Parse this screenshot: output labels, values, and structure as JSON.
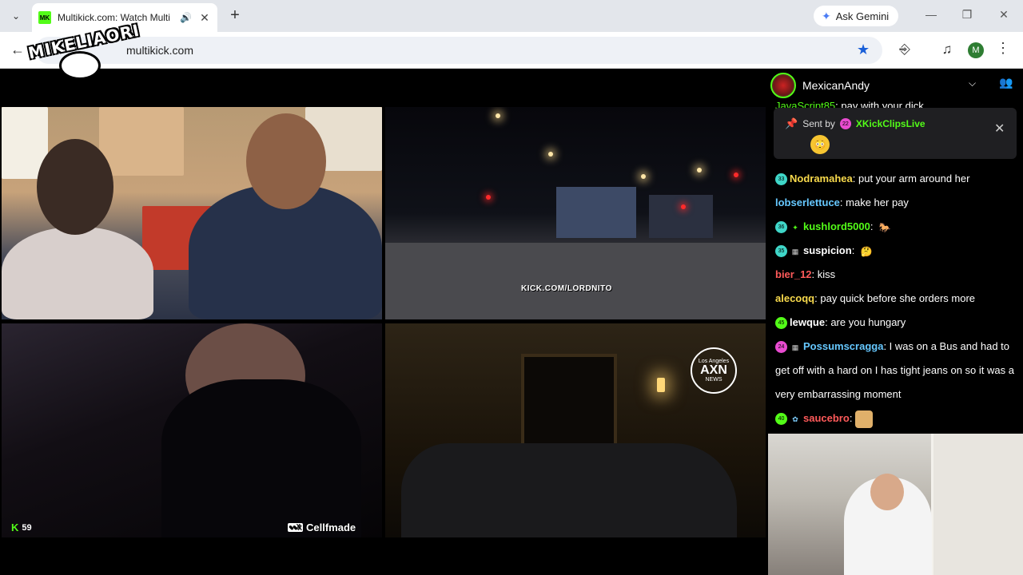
{
  "browser": {
    "tab_title": "Multikick.com: Watch Multi",
    "favicon_text": "MK",
    "new_tab": "+",
    "ask_gemini": "Ask Gemini",
    "url": "multikick.com",
    "profile_initial": "M"
  },
  "watermark": {
    "text": "MIKELIAORI"
  },
  "streams": {
    "tile2_overlay": "KICK.COM/LORDNITO",
    "tile4_logo_top": "Los Angeles",
    "tile4_logo_main": "AXN",
    "tile4_logo_bottom": "NEWS",
    "viewer_count": "59",
    "handle_tag": "Cellfmade"
  },
  "chat": {
    "channel": "MexicanAndy",
    "cut_message": {
      "user": "JavaScript85",
      "text": "pay with your dick"
    },
    "pinned": {
      "sent_by": "Sent by",
      "badge": "22",
      "user": "XKickClipsLive"
    },
    "messages": [
      {
        "badge": "33",
        "user": "Nodramahea",
        "text": "put your arm around her"
      },
      {
        "badge": "",
        "user": "lobserlettuce",
        "text": "make her pay"
      },
      {
        "badge": "36",
        "user": "kushlord5000",
        "text": ""
      },
      {
        "badge": "35",
        "user": "suspicion",
        "text": ""
      },
      {
        "badge": "",
        "user": "bier_12",
        "text": "kiss"
      },
      {
        "badge": "",
        "user": "alecoqq",
        "text": "pay quick before she orders more"
      },
      {
        "badge": "45",
        "user": "lewque",
        "text": "are you hungary"
      },
      {
        "badge": "24",
        "user": "Possumscragga",
        "text": "I was on a Bus and had to get off with a hard on I has tight jeans on so it was a very embarrassing moment"
      },
      {
        "badge": "40",
        "user": "saucebro",
        "text": ""
      }
    ]
  },
  "colors": {
    "kick_green": "#53fc18",
    "user_green": "#53fc18",
    "user_blue": "#66c8ff",
    "user_red": "#ff5a5a",
    "user_yellow": "#f7d94c",
    "user_pink": "#e84bd0",
    "user_cyan": "#3fd6c8"
  }
}
